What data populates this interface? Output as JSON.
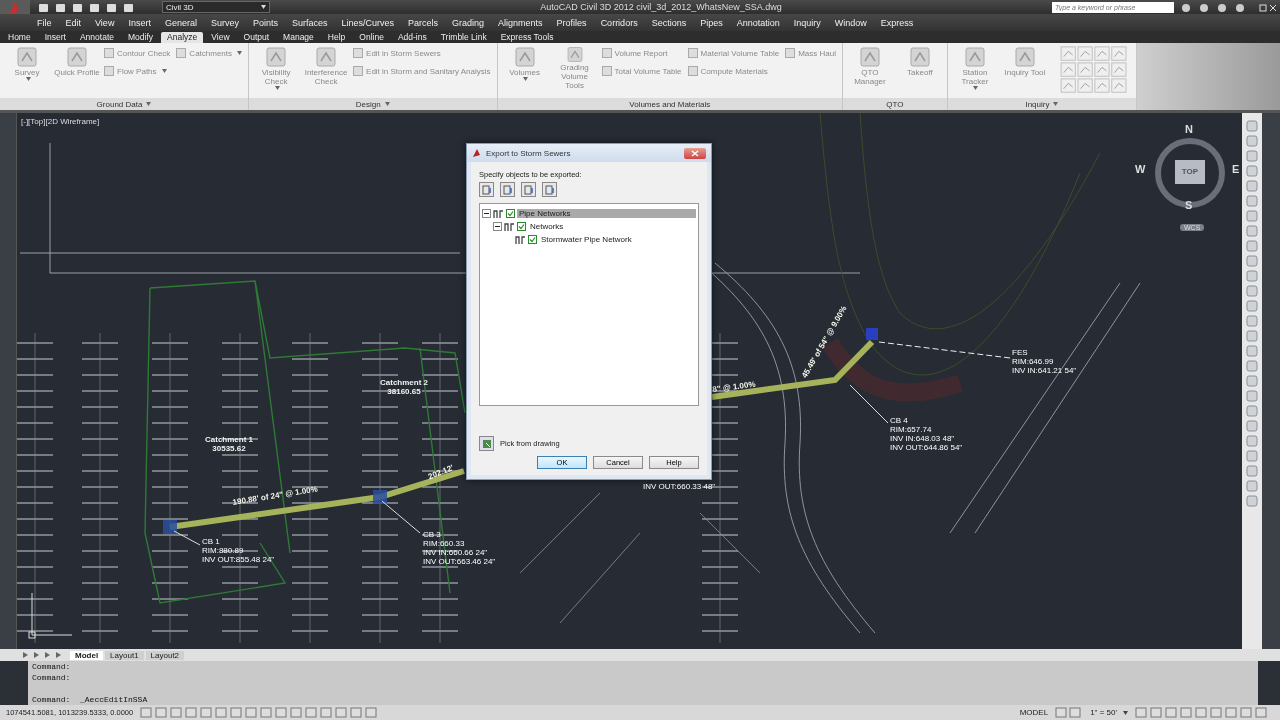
{
  "title_bar": {
    "workspace": "Civil 3D",
    "title": "AutoCAD Civil 3D 2012   civil_3d_2012_WhatsNew_SSA.dwg",
    "search": {
      "placeholder": "Type a keyword or phrase"
    }
  },
  "menu_bar": [
    "File",
    "Edit",
    "View",
    "Insert",
    "General",
    "Survey",
    "Points",
    "Surfaces",
    "Lines/Curves",
    "Parcels",
    "Grading",
    "Alignments",
    "Profiles",
    "Corridors",
    "Sections",
    "Pipes",
    "Annotation",
    "Inquiry",
    "Window",
    "Express"
  ],
  "ribbon_tabs": [
    {
      "label": "Home",
      "selected": false
    },
    {
      "label": "Insert",
      "selected": false
    },
    {
      "label": "Annotate",
      "selected": false
    },
    {
      "label": "Modify",
      "selected": false
    },
    {
      "label": "Analyze",
      "selected": true
    },
    {
      "label": "View",
      "selected": false
    },
    {
      "label": "Output",
      "selected": false
    },
    {
      "label": "Manage",
      "selected": false
    },
    {
      "label": "Help",
      "selected": false
    },
    {
      "label": "Online",
      "selected": false
    },
    {
      "label": "Add-ins",
      "selected": false
    },
    {
      "label": "Trimble Link",
      "selected": false
    },
    {
      "label": "Express Tools",
      "selected": false
    }
  ],
  "ribbon_panels": [
    {
      "title": "Ground Data",
      "dropdown": true,
      "tools": [
        {
          "kind": "large",
          "label": "Survey",
          "dropdown": true
        },
        {
          "kind": "large",
          "label": "Quick Profile",
          "dropdown": false
        },
        {
          "kind": "small",
          "label": "Contour Check",
          "dropdown": false
        },
        {
          "kind": "small",
          "label": "Flow Paths",
          "dropdown": true
        },
        {
          "kind": "small",
          "label": "Catchments",
          "dropdown": true
        }
      ]
    },
    {
      "title": "Design",
      "dropdown": true,
      "tools": [
        {
          "kind": "large",
          "label": "Visibility Check",
          "dropdown": true
        },
        {
          "kind": "large",
          "label": "Interference Check",
          "dropdown": false
        },
        {
          "kind": "small",
          "label": "Edit in Storm Sewers",
          "dropdown": false
        },
        {
          "kind": "small",
          "label": "Edit in Storm and Sanitary Analysis",
          "dropdown": false
        }
      ]
    },
    {
      "title": "Volumes and Materials",
      "dropdown": false,
      "tools": [
        {
          "kind": "large",
          "label": "Volumes",
          "dropdown": true
        },
        {
          "kind": "large",
          "label": "Grading Volume Tools",
          "dropdown": false
        },
        {
          "kind": "small",
          "label": "Volume Report",
          "dropdown": false
        },
        {
          "kind": "small",
          "label": "Total Volume Table",
          "dropdown": false
        },
        {
          "kind": "small",
          "label": "Material Volume Table",
          "dropdown": false
        },
        {
          "kind": "small",
          "label": "Compute Materials",
          "dropdown": false
        },
        {
          "kind": "small",
          "label": "Mass Haul",
          "dropdown": false
        }
      ]
    },
    {
      "title": "QTO",
      "dropdown": false,
      "tools": [
        {
          "kind": "large",
          "label": "QTO Manager",
          "dropdown": false
        },
        {
          "kind": "large",
          "label": "Takeoff",
          "dropdown": false
        }
      ]
    },
    {
      "title": "Inquiry",
      "dropdown": true,
      "tools": [
        {
          "kind": "large",
          "label": "Station Tracker",
          "dropdown": true
        },
        {
          "kind": "large",
          "label": "Inquiry Tool",
          "dropdown": false
        },
        {
          "kind": "icon_grid"
        }
      ]
    }
  ],
  "viewport": {
    "label": "[-][Top][2D Wireframe]"
  },
  "view_cube": {
    "north": "N",
    "south": "S",
    "east": "E",
    "west": "W",
    "face": "TOP",
    "ucs": "WCS"
  },
  "annotations": [
    {
      "kind": "area",
      "lines": [
        "Catchment 1",
        "30535.62"
      ]
    },
    {
      "kind": "area",
      "lines": [
        "Catchment 2",
        "38160.65"
      ]
    },
    {
      "kind": "structure",
      "lines": [
        "CB 1",
        "RIM:880.89",
        "INV OUT:855.48 24\""
      ]
    },
    {
      "kind": "structure",
      "lines": [
        "CB 3",
        "RIM:660.33",
        "INV IN:660.66 24\"",
        "INV OUT:663.46 24\""
      ]
    },
    {
      "kind": "structure",
      "lines": [
        "FES",
        "RIM:646.99",
        "INV IN:641.21 54\""
      ]
    },
    {
      "kind": "structure",
      "lines": [
        "CB 4",
        "RIM:657.74",
        "INV IN:648.03 48\"",
        "INV OUT:644.86 54\""
      ]
    },
    {
      "kind": "structure",
      "lines": [
        "INV OUT:660.33 48\""
      ]
    },
    {
      "kind": "pipe",
      "lines": [
        "190.88' of 24\" @ 1.00%"
      ]
    },
    {
      "kind": "pipe",
      "lines": [
        "202.12'"
      ]
    },
    {
      "kind": "pipe",
      "lines": [
        "8\" @ 1.00%"
      ]
    },
    {
      "kind": "pipe",
      "lines": [
        "45.49' of 54\" @ 9.00%"
      ]
    }
  ],
  "dialog": {
    "title": "Export to Storm Sewers",
    "prompt": "Specify objects to be exported:",
    "tree": [
      {
        "label": "Pipe Networks",
        "checked": true,
        "expanded": true,
        "selected": true,
        "children": [
          {
            "label": "Networks",
            "checked": true,
            "expanded": true,
            "selected": false,
            "children": [
              {
                "label": "Stormwater Pipe Network",
                "checked": true,
                "selected": false
              }
            ]
          }
        ]
      }
    ],
    "pick_label": "Pick from drawing",
    "buttons": [
      "OK",
      "Cancel",
      "Help"
    ]
  },
  "layout_tabs": [
    {
      "label": "Model",
      "selected": true
    },
    {
      "label": "Layout1",
      "selected": false
    },
    {
      "label": "Layout2",
      "selected": false
    }
  ],
  "command_lines": [
    "Command:",
    "Command:",
    "Command:  _AeccEditInSSA"
  ],
  "status_bar": {
    "coordinates": "1074541.5081, 1013239.5333, 0.0000",
    "space": "MODEL",
    "scale": "1\" = 50'"
  }
}
